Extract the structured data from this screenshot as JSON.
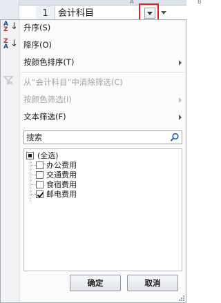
{
  "sheet": {
    "col_letter_a": "A",
    "col_letter_b": "B",
    "row_number": "1",
    "cell_value": "会计科目"
  },
  "menu": {
    "sort_ascending": "升序(S)",
    "sort_descending": "降序(O)",
    "sort_by_color": "按颜色排序(T)",
    "clear_filter": "从“会计科目”中清除筛选(C)",
    "filter_by_color": "按颜色筛选(I)",
    "text_filter": "文本筛选(F)"
  },
  "search": {
    "placeholder": "搜索"
  },
  "filter_list": [
    {
      "label": "(全选)",
      "state": "mixed"
    },
    {
      "label": "办公费用",
      "state": "unchecked"
    },
    {
      "label": "交通费用",
      "state": "unchecked"
    },
    {
      "label": "食宿费用",
      "state": "unchecked"
    },
    {
      "label": "邮电费用",
      "state": "checked"
    }
  ],
  "buttons": {
    "ok": "确定",
    "cancel": "取消"
  },
  "colors": {
    "highlight": "#e02020",
    "search_icon": "#1f5fa8"
  }
}
